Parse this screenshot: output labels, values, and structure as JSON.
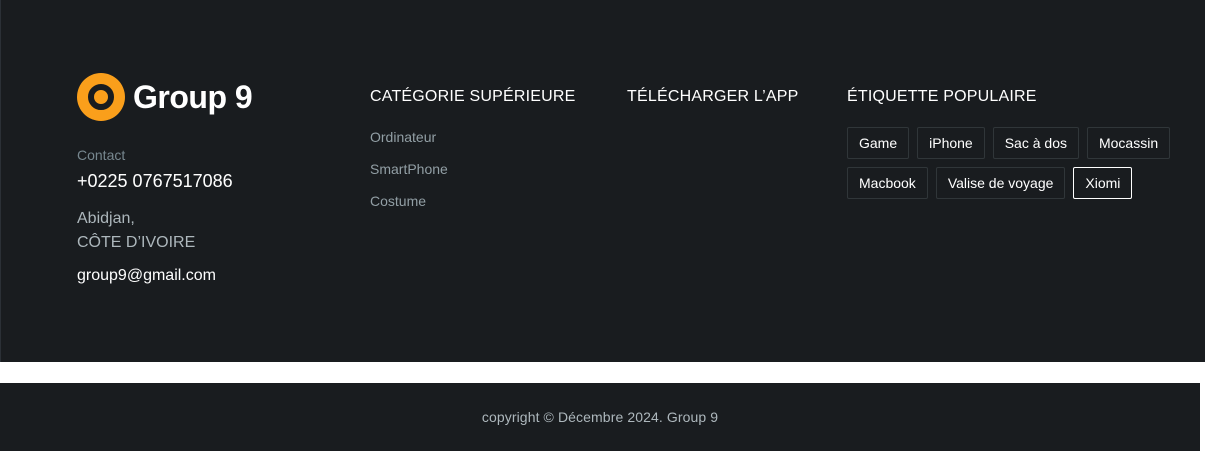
{
  "brand": {
    "name": "Group 9",
    "logo_icon": "ring-logo-icon",
    "logo_color": "#fa9f1b"
  },
  "contact": {
    "label": "Contact",
    "phone": "+0225 0767517086",
    "address_line1": "Abidjan,",
    "address_line2": "CÔTE D’IVOIRE",
    "email": "group9@gmail.com"
  },
  "categories": {
    "heading": "CATÉGORIE SUPÉRIEURE",
    "items": [
      "Ordinateur",
      "SmartPhone",
      "Costume"
    ]
  },
  "app": {
    "heading": "TÉLÉCHARGER L’APP"
  },
  "tags": {
    "heading": "ÉTIQUETTE POPULAIRE",
    "items": [
      "Game",
      "iPhone",
      "Sac à dos",
      "Mocassin",
      "Macbook",
      "Valise de voyage",
      "Xiomi"
    ],
    "active": "Xiomi"
  },
  "footer": {
    "copyright": "copyright © Décembre 2024. Group 9"
  },
  "colors": {
    "background": "#191c1f",
    "accent": "#fa9f1b",
    "muted_text": "#adb7bc"
  }
}
